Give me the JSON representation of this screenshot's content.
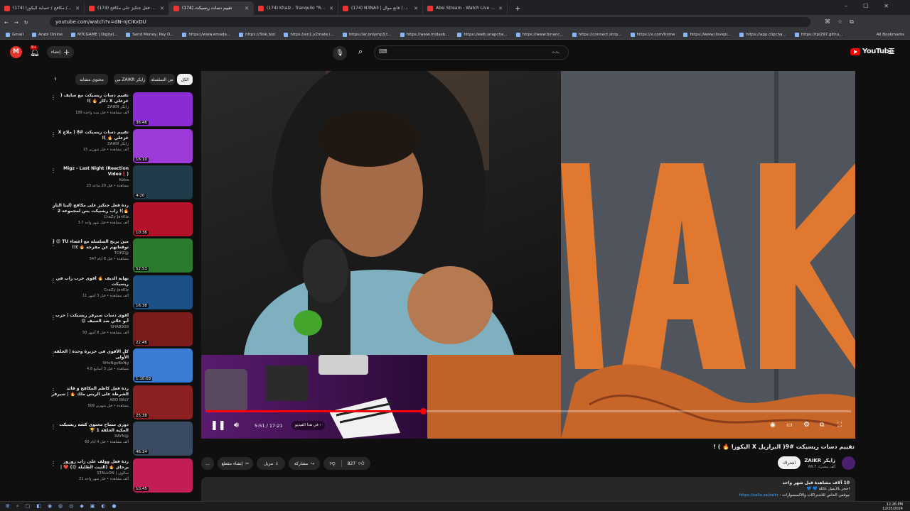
{
  "browser": {
    "tabs": [
      {
        "label": "(174) مكافح / عصابة اليكوزا / ..."
      },
      {
        "label": "(174) ردة فعل جنكيز على مكافح"
      },
      {
        "label": "(174) تقييم دسات ريسيكت",
        "active": true
      },
      {
        "label": "(174) Khalz - Tranquilo \"Remix\""
      },
      {
        "label": "(174) N3NA3 | فانع موال ( Offi"
      },
      {
        "label": "Absi Stream - Watch Live on Ki"
      }
    ],
    "new_tab": "+",
    "url": "youtube.com/watch?v=dN-njCiKxDU",
    "bookmarks": [
      "Gmail",
      "Arabi Online",
      "MTCGAME | Digital...",
      "Send Money, Pay O...",
      "https://www.emada...",
      "https://3isk.biz/",
      "https://en1.y2mate.i...",
      "https://ar.onlymp3.t...",
      "https://www.midasb...",
      "https://web.snapcha...",
      "https://www.binanc...",
      "https://connect.strip...",
      "https://x.com/home",
      "https://www.ilovepi...",
      "https://app.clipcha...",
      "https://tpi297.githu..."
    ],
    "all_bookmarks": "All Bookmarks"
  },
  "header": {
    "avatar_letter": "M",
    "notif_count": "9+",
    "create_label": "إنشاء",
    "search_placeholder": "بحث",
    "brand": "YouTube"
  },
  "chips": [
    {
      "label": "الكل",
      "selected": true
    },
    {
      "label": "من السلسلة",
      "selected": false
    },
    {
      "label": "من ZAiKR زايكر",
      "selected": false
    },
    {
      "label": "محتوى مشابه",
      "selected": false
    }
  ],
  "player": {
    "time": "5:51 / 17:21",
    "progress": 0.337,
    "chapter": "في هذا الفيديو",
    "logo_text": "ZAiK"
  },
  "sidebar_videos": [
    {
      "title": "تقييم دسات ريسيكت مع سايف ( غزعلي X دكار 🔥 )!",
      "channel": "ZAiKR زايكر",
      "meta": "189 ألف مشاهدة • قبل سنة واحدة",
      "duration": "36:46",
      "thumb": "#8a2bd6"
    },
    {
      "title": "تقييم دسات ريسيكت #8 ( ملاح X غزعلي 🔥 )!",
      "channel": "ZAiKR زايكر",
      "meta": "15 ألف مشاهدة • قبل شهرين",
      "duration": "16:10",
      "thumb": "#9d3bd9"
    },
    {
      "title": "Migz - Last Night (Reaction Video❗)",
      "channel": "Koba",
      "meta": "23 مشاهدة • قبل 20 ساعة",
      "duration": "4:20",
      "thumb": "#1f3b4a"
    },
    {
      "title": "ردة فعل جنكيز على مكافح (لينا الثأر 🔥)! راب ريسيكت بس لمجموعة 2 محمدي 🔥",
      "channel": "CraZy JanKiz",
      "meta": "3.7 ألف مشاهدة • قبل شهر واحد",
      "duration": "10:36",
      "thumb": "#b3122a"
    },
    {
      "title": "مين يربح السلسلة مع أعضاء TU 😍 ( توقعاتهم عن مفرخة 🔥 )!!",
      "channel": "TOPZ@",
      "meta": "547 مشاهدة • قبل 6 أيام",
      "duration": "52:53",
      "thumb": "#2c7a2e"
    },
    {
      "title": "نهاية الديف 🔥 أقوى حرب راب في ريسيكت",
      "channel": "CraZy JanKiz",
      "meta": "11 ألف مشاهدة • قبل 3 أشهر",
      "duration": "16:38",
      "thumb": "#1b4f86"
    },
    {
      "title": "أقوى دسات سيرفر ريسيكت | حرب أبو عالي ضد السيف 😡",
      "channel": "SHAB909",
      "meta": "50 ألف مشاهدة • قبل 8 أشهر",
      "duration": "22:46",
      "thumb": "#7a1c1c"
    },
    {
      "title": "كل الأقوى في جزيرة وحدة | الحلقة الأولى",
      "channel": "SHoNgxBoNg",
      "meta": "4.8 مشاهدة • قبل 3 أسابيع",
      "duration": "1:10:03",
      "thumb": "#3a7bd5"
    },
    {
      "title": "ردة فعل كاظم المكافح و قائد الشرطة على الريس ملك 🔥 | سيرفر ريسيكت 🔥",
      "channel": "ABO BALY",
      "meta": "509 مشاهدة • قبل شهرين",
      "duration": "25:38",
      "thumb": "#8c2020"
    },
    {
      "title": "دوري سماح محتوى كشة ريسيكت المكية الحلقة 1 🏆",
      "channel": "RAYN@",
      "meta": "60 ألف مشاهدة • قبل 4 أيام",
      "duration": "46:34",
      "thumb": "#394a62"
    },
    {
      "title": "ردة فعل وولف على راب زوزوز يرحاي 🔥 (الثيت الظليلة 😍) ❤️ | ...espect",
      "channel": "STALLON | سالون",
      "meta": "21 ألف مشاهدة • قبل شهر واحد",
      "duration": "10:45",
      "thumb": "#c21d57"
    }
  ],
  "video": {
    "title": "تقييم دسات ريسيكت #9( البرازيل X اليكوزا 🔥 ) !",
    "channel": "ZAiKR زايكر",
    "subscribers": "66.7 ألف مشترك",
    "subscribe_label": "اشتراك",
    "like_count": "827",
    "share_label": "مشاركة",
    "download_label": "تنزيل",
    "clip_label": "إنشاء مقطع",
    "more_label": "..."
  },
  "description": {
    "stats": "10 آلاف مشاهدة  قبل شهر واحد",
    "line1": "احجز بالايميل عائلة 💙 💙",
    "line2": "موقعي الخاص للاشتراكات والاكسسوارات :",
    "link": "https://salla.sa/zaikr"
  },
  "taskbar": {
    "time": "12:26 PM",
    "date": "12/25/2024"
  },
  "colors": {
    "accent": "#ff0000",
    "bg": "#0f0f0f",
    "chip": "#272727",
    "logo_orange": "#e1782f"
  }
}
